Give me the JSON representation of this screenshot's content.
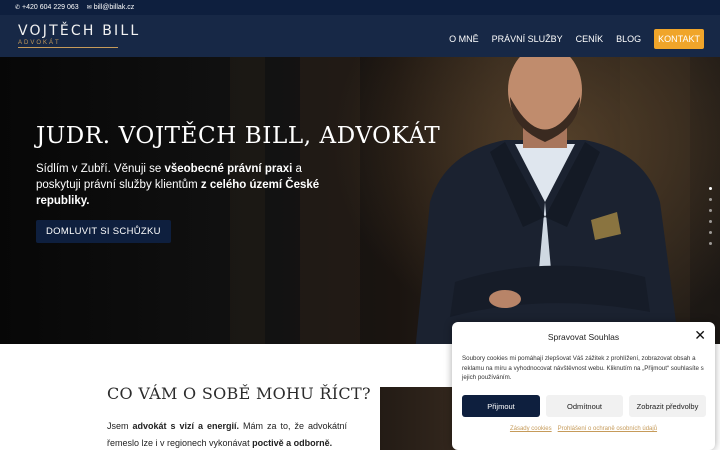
{
  "topbar": {
    "phone_icon": "phone-icon",
    "phone": "+420 604 229 063",
    "email_icon": "envelope-icon",
    "email": "bill@billak.cz"
  },
  "header": {
    "logo_name": "VOJTĚCH BILL",
    "logo_sub": "ADVOKÁT",
    "nav": [
      {
        "label": "O MNĚ"
      },
      {
        "label": "PRÁVNÍ SLUŽBY"
      },
      {
        "label": "CENÍK"
      },
      {
        "label": "BLOG"
      }
    ],
    "cta": "KONTAKT"
  },
  "hero": {
    "title": "JUDR. VOJTĚCH BILL, ADVOKÁT",
    "desc_1": "Sídlím v Zubří. Věnuji se ",
    "desc_bold_1": "všeobecné právní praxi",
    "desc_2": " a poskytuji právní služby klientům ",
    "desc_bold_2": "z celého území České republiky.",
    "button": "DOMLUVIT SI SCHŮZKU",
    "slides_total": 6,
    "slide_active": 1
  },
  "section": {
    "title": "CO VÁM O SOBĚ MOHU ŘÍCT?",
    "text_1": "Jsem ",
    "text_bold_1": "advokát s vizí a energií.",
    "text_2": " Mám za to, že advokátní řemeslo lze i v regionech vykonávat ",
    "text_bold_2": "poctivě a odborně."
  },
  "cookie": {
    "title": "Spravovat Souhlas",
    "text": "Soubory cookies mi pomáhají zlepšovat Váš zážitek z prohlížení, zobrazovat obsah a reklamu na míru a vyhodnocovat návštěvnost webu. Kliknutím na „Přijmout“ souhlasíte s jejich používáním.",
    "accept": "Přijmout",
    "deny": "Odmítnout",
    "prefs": "Zobrazit předvolby",
    "link_cookies": "Zásady cookies",
    "link_privacy": "Prohlášení o ochraně osobních údajů"
  },
  "colors": {
    "navy": "#0e1f3e",
    "gold": "#c69b5a",
    "cta_orange": "#f0a52a"
  }
}
